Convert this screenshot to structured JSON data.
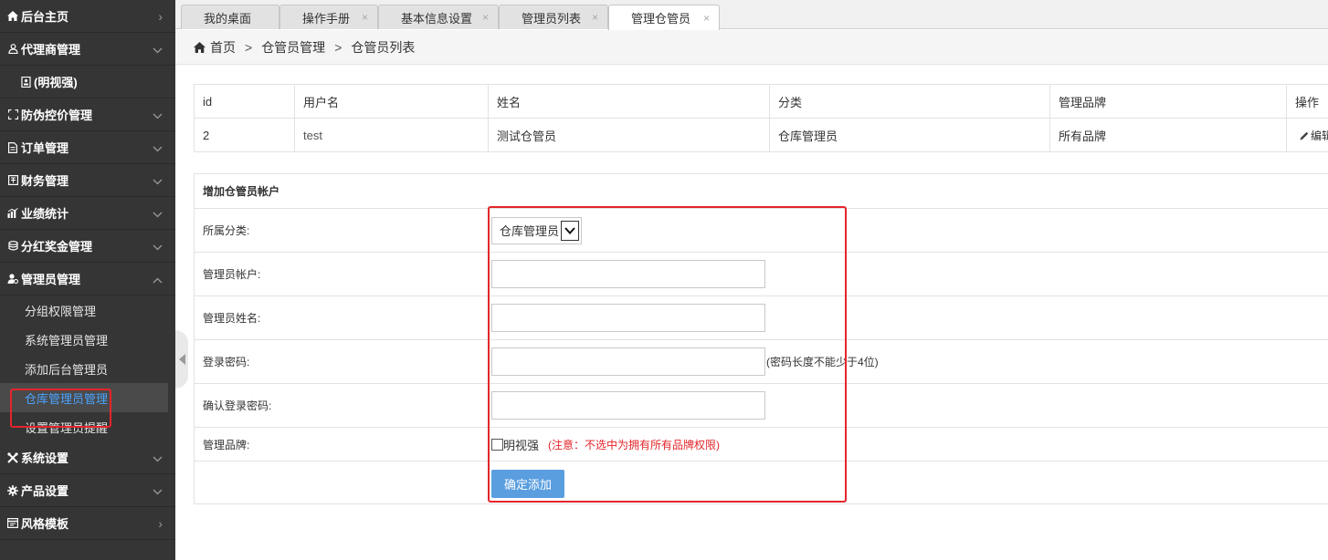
{
  "sidebar": {
    "items": [
      {
        "label": "后台主页",
        "icon": "home-icon",
        "arrow": "›"
      },
      {
        "label": "代理商管理",
        "icon": "user-icon",
        "arrow": "⌄"
      },
      {
        "label": "(明视强)",
        "icon": "badge-icon"
      },
      {
        "label": "防伪控价管理",
        "icon": "scan-icon",
        "arrow": "⌄"
      },
      {
        "label": "订单管理",
        "icon": "file-icon",
        "arrow": "⌄"
      },
      {
        "label": "财务管理",
        "icon": "ledger-icon",
        "arrow": "⌄"
      },
      {
        "label": "业绩统计",
        "icon": "bar-chart-icon",
        "arrow": "⌄"
      },
      {
        "label": "分红奖金管理",
        "icon": "database-icon",
        "arrow": "⌄"
      },
      {
        "label": "管理员管理",
        "icon": "admin-icon",
        "arrow": "⌃"
      },
      {
        "label": "系统设置",
        "icon": "tools-icon",
        "arrow": "⌄"
      },
      {
        "label": "产品设置",
        "icon": "gear-icon",
        "arrow": "⌄"
      },
      {
        "label": "风格模板",
        "icon": "window-icon",
        "arrow": "›"
      }
    ],
    "admin_sub": [
      {
        "label": "分组权限管理"
      },
      {
        "label": "系统管理员管理"
      },
      {
        "label": "添加后台管理员"
      },
      {
        "label": "仓库管理员管理"
      },
      {
        "label": "设置管理员提醒"
      }
    ]
  },
  "tabs": [
    {
      "label": "我的桌面"
    },
    {
      "label": "操作手册",
      "close": "×"
    },
    {
      "label": "基本信息设置",
      "close": "×"
    },
    {
      "label": "管理员列表",
      "close": "×"
    },
    {
      "label": "管理仓管员",
      "close": "×"
    }
  ],
  "breadcrumb": {
    "home": "首页",
    "sep": ">",
    "level1": "仓管员管理",
    "level2": "仓管员列表"
  },
  "table": {
    "headers": [
      "id",
      "用户名",
      "姓名",
      "分类",
      "管理品牌",
      "操作"
    ],
    "rows": [
      {
        "id": "2",
        "username": "test",
        "name": "测试仓管员",
        "category": "仓库管理员",
        "brand": "所有品牌",
        "action": "编辑"
      }
    ]
  },
  "form": {
    "title": "增加仓管员帐户",
    "category_label": "所属分类:",
    "category_value": "仓库管理员",
    "account_label": "管理员帐户:",
    "account_value": "",
    "name_label": "管理员姓名:",
    "name_value": "",
    "password_label": "登录密码:",
    "password_value": "",
    "password_hint": "(密码长度不能少于4位)",
    "confirm_label": "确认登录密码:",
    "confirm_value": "",
    "brand_label": "管理品牌:",
    "brand_option": "明视强",
    "brand_checked": false,
    "brand_note": "(注意：不选中为拥有所有品牌权限)",
    "submit": "确定添加"
  },
  "colors": {
    "sidebar_bg": "#353535",
    "active_link": "#4aa3ff",
    "highlight": "#e4252b",
    "button": "#5a9ee0"
  }
}
